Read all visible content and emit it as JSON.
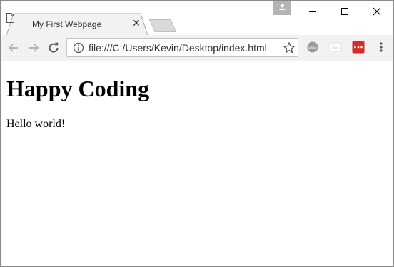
{
  "browser": {
    "tab": {
      "title": "My First Webpage",
      "close_glyph": "✕",
      "icon": "document-icon"
    },
    "new_tab_icon": "new-tab-icon",
    "window_controls": [
      "minimize-icon",
      "maximize-icon",
      "close-icon"
    ],
    "toolbar": {
      "back_icon": "arrow-left-icon",
      "forward_icon": "arrow-right-icon",
      "reload_icon": "reload-icon",
      "url": "file:///C:/Users/Kevin/Desktop/index.html",
      "site_info_icon": "info-icon",
      "bookmark_icon": "star-icon",
      "extensions": [
        "www-extension-icon",
        "page-extension-icon",
        "red-extension-icon"
      ],
      "menu_icon": "kebab-menu-icon"
    },
    "colors": {
      "chrome": "#f2f2f2",
      "profile_badge": "#b4b4b4",
      "red_extension": "#d32d27"
    }
  },
  "page": {
    "heading": "Happy Coding",
    "paragraph": "Hello world!"
  }
}
